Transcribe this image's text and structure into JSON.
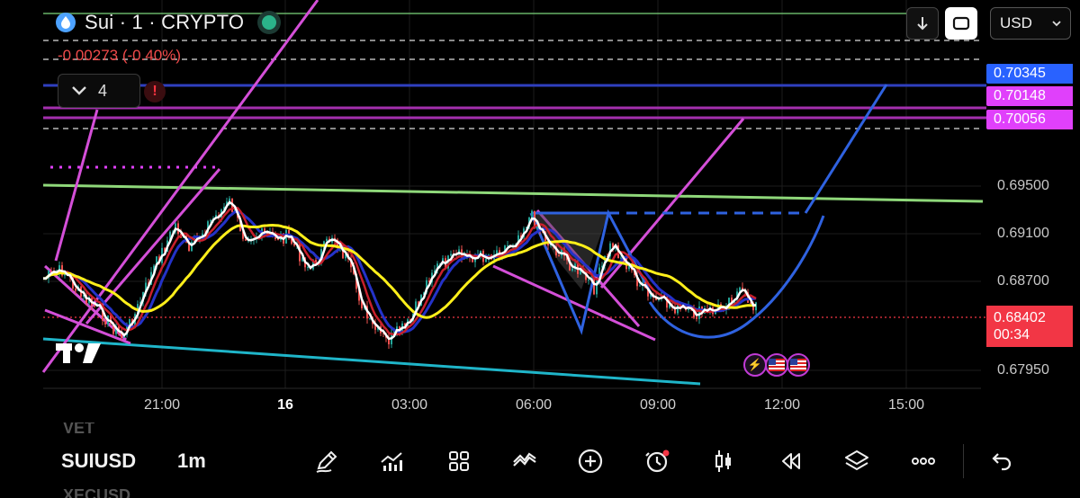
{
  "header": {
    "symbol_title": "Sui · 1 · CRYPTO",
    "change_text": "-0.00273 (-0.40%)",
    "indicators_count": "4",
    "alert_label": "!",
    "currency": "USD"
  },
  "price_axis": {
    "labels": [
      {
        "text": "0.69500",
        "price": 0.695
      },
      {
        "text": "0.69100",
        "price": 0.691
      },
      {
        "text": "0.68700",
        "price": 0.687
      },
      {
        "text": "0.67950",
        "price": 0.6795
      }
    ],
    "tags": [
      {
        "text": "0.70345",
        "price": 0.70345,
        "color": "#2962ff"
      },
      {
        "text": "0.70148",
        "price": 0.70148,
        "color": "#e040fb"
      },
      {
        "text": "0.70056",
        "price": 0.70056,
        "color": "#e040fb"
      }
    ],
    "current_price": "0.68402",
    "countdown": "00:34"
  },
  "time_axis": [
    {
      "text": "21:00",
      "bold": false
    },
    {
      "text": "16",
      "bold": true
    },
    {
      "text": "03:00",
      "bold": false
    },
    {
      "text": "06:00",
      "bold": false
    },
    {
      "text": "09:00",
      "bold": false
    },
    {
      "text": "12:00",
      "bold": false
    },
    {
      "text": "15:00",
      "bold": false
    }
  ],
  "bottom_bar": {
    "symbol": "SUIUSD",
    "interval": "1m",
    "ghost_above": "VET",
    "ghost_below": "XECUSD",
    "tools": [
      "pencil-icon",
      "indicators-icon",
      "grid-icon",
      "pattern-icon",
      "add-icon",
      "alert-clock-icon",
      "candles-icon",
      "replay-icon",
      "layers-icon",
      "more-icon"
    ]
  },
  "colors": {
    "up": "#26a69a",
    "down": "#ef5350",
    "accent_red": "#f23645",
    "magenta": "#d94fd6",
    "blue_line": "#2f5bd8"
  }
}
